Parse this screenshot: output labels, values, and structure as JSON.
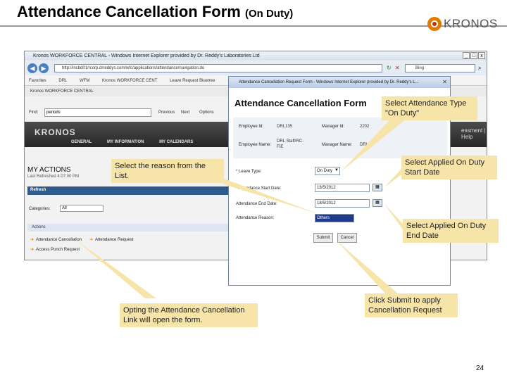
{
  "slide": {
    "title": "Attendance Cancellation Form",
    "title_suffix": "(On Duty)",
    "logo_text": "KRONOS",
    "page_number": "24"
  },
  "ie_window": {
    "title": "Kronos WORKFORCE CENTRAL - Windows Internet Explorer provided by Dr. Reddy's Laboratories Ltd",
    "address": "http://incbd01/rcorp.drreddys.com/wfc/applications/attendance/navigation.do",
    "search_placeholder": "Bing",
    "favorites": [
      "Favorites",
      "DRL",
      "WFM",
      "Kronos WORKFORCE CENT",
      "Leave Request Bluetree"
    ],
    "tab_label": "Kronos WORKFORCE CENTRAL",
    "find_label": "Find:",
    "find_value": "periods",
    "find_buttons": [
      "Previous",
      "Next",
      "Options"
    ],
    "right_header_text": "essment | Help"
  },
  "kronos": {
    "brand": "KRONOS",
    "menu": [
      "GENERAL",
      "MY INFORMATION",
      "MY CALENDARS"
    ],
    "my_actions_title": "MY ACTIONS",
    "last_refreshed": "Last Refreshed 4:07:00 PM",
    "refresh_label": "Refresh",
    "categories_label": "Categories:",
    "categories_value": "All",
    "actions_header": "Actions",
    "action_links": [
      "Attendance Cancellation",
      "Attendance Request",
      "Access Punch Request"
    ]
  },
  "popup": {
    "title": "Attendance Cancellation Request Form - Windows Internet Explorer provided by Dr. Reddy's L...",
    "heading": "Attendance Cancellation Form",
    "employee_id_label": "Employee Id:",
    "employee_id_value": "DRL135",
    "manager_id_label": "Manager Id:",
    "manager_id_value": "2202",
    "employee_name_label": "Employee Name:",
    "employee_name_value": "DRL Staff/RC-FIE",
    "manager_name_label": "Manager Name:",
    "manager_name_value": "DRL",
    "leave_type_label": "* Leave Type:",
    "leave_type_value": "On Duty",
    "start_date_label": "* Attendance Start Date:",
    "start_date_value": "18/5/2012",
    "end_date_label": "Attendance End Date:",
    "end_date_value": "18/5/2012",
    "reason_label": "Attendance Reason:",
    "reason_value": "Others",
    "submit_label": "Submit",
    "cancel_label": "Cancel"
  },
  "callouts": {
    "attendance_type": "Select Attendance Type \"On Duty\"",
    "reason": "Select the reason from the List.",
    "start_date": "Select Applied On Duty Start Date",
    "end_date": "Select Applied On Duty End Date",
    "opting_link": "Opting the Attendance Cancellation Link will open the form.",
    "submit": "Click Submit to apply Cancellation Request"
  },
  "colors": {
    "callout_bg": "#f6e4a9",
    "kronos_header": "#333333",
    "logo_accent": "#e07a00",
    "reason_highlight": "#203a8a"
  }
}
